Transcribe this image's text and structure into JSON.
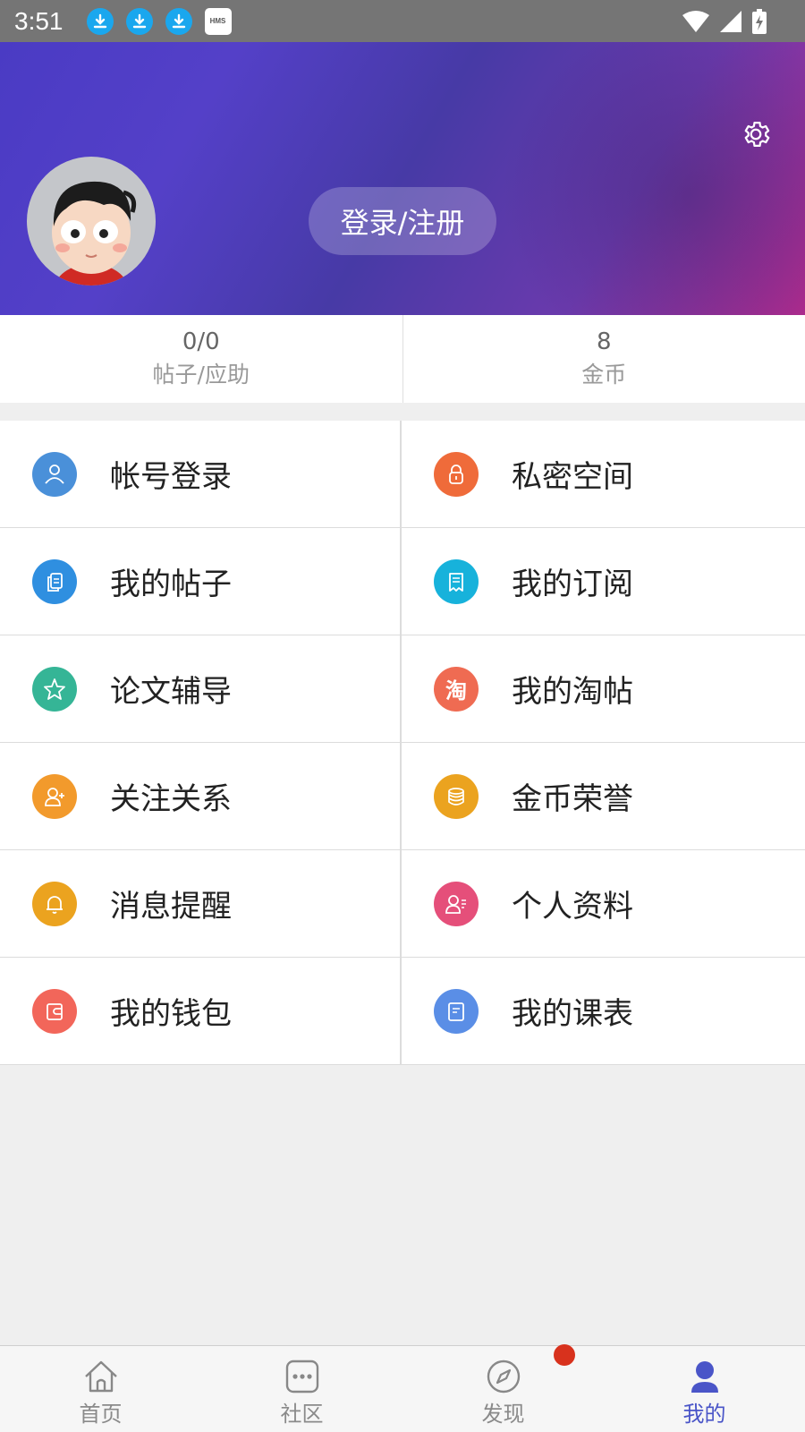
{
  "status_bar": {
    "time": "3:51",
    "hms_label": "HMS"
  },
  "header": {
    "login_label": "登录/注册"
  },
  "stats": [
    {
      "value": "0/0",
      "label": "帖子/应助"
    },
    {
      "value": "8",
      "label": "金币"
    }
  ],
  "menu": [
    {
      "label": "帐号登录",
      "icon": "user-icon",
      "color": "#4a90d9"
    },
    {
      "label": "私密空间",
      "icon": "lock-icon",
      "color": "#ef6b3a"
    },
    {
      "label": "我的帖子",
      "icon": "documents-icon",
      "color": "#2f8fe0"
    },
    {
      "label": "我的订阅",
      "icon": "receipt-icon",
      "color": "#17b2db"
    },
    {
      "label": "论文辅导",
      "icon": "star-icon",
      "color": "#35b596"
    },
    {
      "label": "我的淘帖",
      "icon": "tao-icon",
      "color": "#ef6b52",
      "glyph": "淘"
    },
    {
      "label": "关注关系",
      "icon": "follow-user-icon",
      "color": "#f29a2c"
    },
    {
      "label": "金币荣誉",
      "icon": "coins-icon",
      "color": "#eba31f"
    },
    {
      "label": "消息提醒",
      "icon": "bell-icon",
      "color": "#eba31f"
    },
    {
      "label": "个人资料",
      "icon": "profile-icon",
      "color": "#e54f7a"
    },
    {
      "label": "我的钱包",
      "icon": "wallet-icon",
      "color": "#f2665a"
    },
    {
      "label": "我的课表",
      "icon": "schedule-icon",
      "color": "#5a8ee6"
    }
  ],
  "bottom_nav": [
    {
      "label": "首页",
      "icon": "home-icon"
    },
    {
      "label": "社区",
      "icon": "community-icon"
    },
    {
      "label": "发现",
      "icon": "compass-icon"
    },
    {
      "label": "我的",
      "icon": "person-icon",
      "active": true
    }
  ],
  "colors": {
    "accent": "#4a55c8",
    "badge": "#d8321d"
  }
}
